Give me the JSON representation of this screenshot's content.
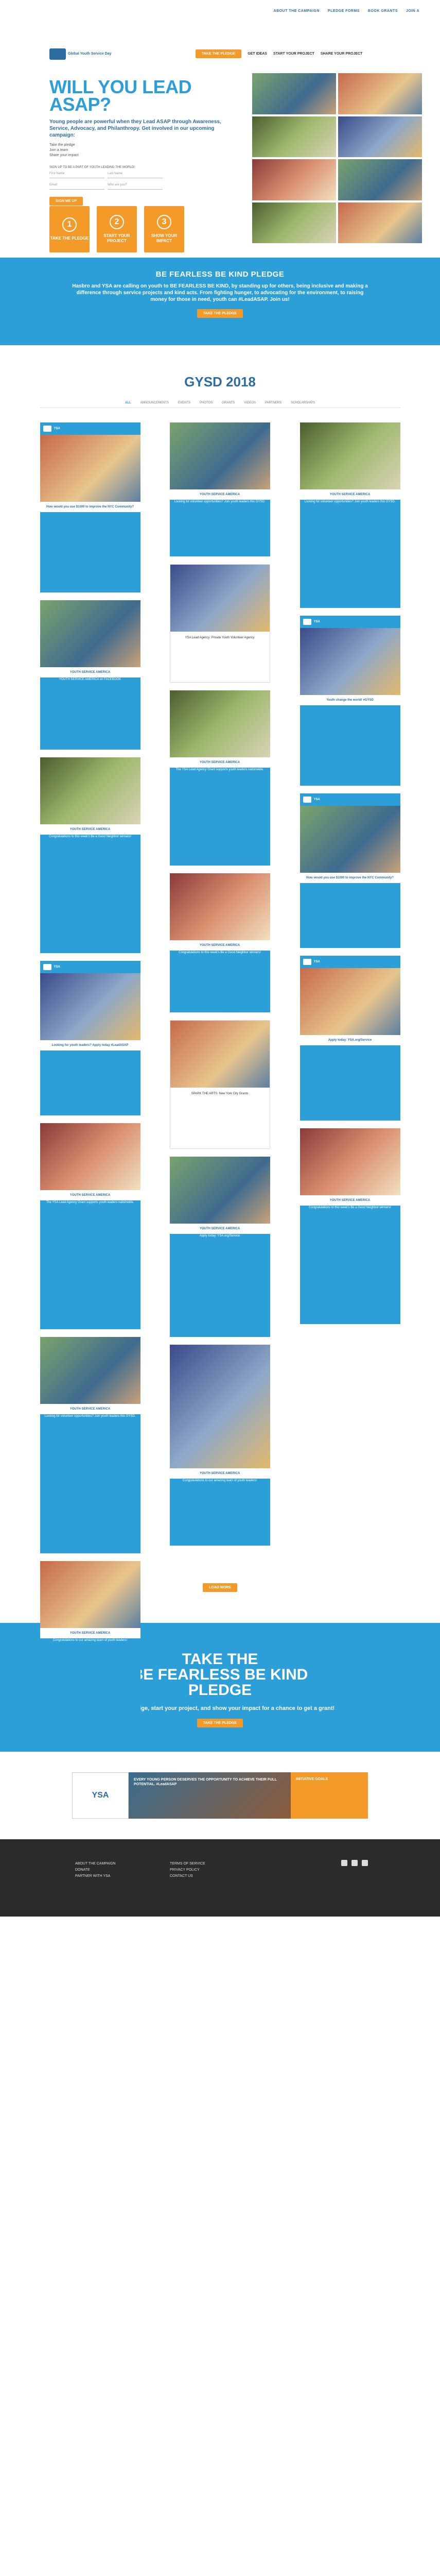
{
  "topnav": {
    "links": [
      "ABOUT THE CAMPAIGN",
      "PLEDGE FORMS",
      "BOOK GRANTS",
      "JOIN A"
    ]
  },
  "hero": {
    "logo_text": "Global Youth Service Day",
    "cta_button": "TAKE THE PLEDGE",
    "cta_links": [
      "GET IDEAS",
      "START YOUR PROJECT",
      "SHARE YOUR PROJECT"
    ],
    "headline": "WILL YOU LEAD ASAP?",
    "subhead": "Young people are powerful when they Lead ASAP through Awareness, Service, Advocacy, and Philanthropy. Get involved in our upcoming campaign:",
    "bullets": [
      "Take the pledge",
      "Join a team",
      "Share your impact"
    ],
    "form_label": "SIGN UP TO BE A PART OF YOUTH LEADING THE WORLD!",
    "form_fields": [
      "First Name",
      "Last Name",
      "Email",
      "Who are you?"
    ],
    "submit": "SIGN ME UP",
    "steps": [
      {
        "num": "1",
        "label": "TAKE THE PLEDGE"
      },
      {
        "num": "2",
        "label": "START YOUR PROJECT"
      },
      {
        "num": "3",
        "label": "SHOW YOUR IMPACT"
      }
    ]
  },
  "pledge": {
    "title": "BE FEARLESS BE KIND PLEDGE",
    "text": "Hasbro and YSA are calling on youth to BE FEARLESS BE KIND, by standing up for others, being inclusive and making a difference through service projects and kind acts. From fighting hunger, to advocating for the environment, to raising money for those in need, youth can #LeadASAP. Join us!",
    "button": "TAKE THE PLEDGE"
  },
  "gysd": {
    "title": "GYSD 2018",
    "filters": [
      "ALL",
      "ANNOUNCEMENTS",
      "EVENTS",
      "PHOTOS",
      "GRANTS",
      "VIDEOS",
      "PARTNERS",
      "SCHOLARSHIPS"
    ]
  },
  "cards": [
    {
      "name": "YSA",
      "text": "How would you use $1000 to improve the NYC Community?"
    },
    {
      "name": "YOUTH SERVICE AMERICA",
      "text": "YOUTH SERVICE AMERICA on FACEBOOK"
    },
    {
      "name": "YSA",
      "text": "Looking for youth leaders? Apply today #LeadASAP"
    },
    {
      "name": "YOUTH SERVICE AMERICA",
      "text": "Looking for volunteer opportunities? Join youth leaders this GYSD."
    },
    {
      "name": "YSA Lead Agency",
      "text": "YSA Lead Agency: Private Youth Volunteer Agency"
    },
    {
      "name": "YSA",
      "text": "Youth change the world! #GYSD"
    },
    {
      "name": "YOUTH SERVICE AMERICA",
      "text": "Congratulations to this week's Be a Good Neighbor winners!"
    },
    {
      "name": "YSA",
      "text": "SPARK THE ARTS: New York City Grants"
    },
    {
      "name": "YOUTH SERVICE AMERICA",
      "text": "The YSA Lead Agency Grant supports youth leaders nationwide."
    },
    {
      "name": "YSA",
      "text": "Apply today: YSA.org/Service"
    },
    {
      "name": "YOUTH SERVICE AMERICA",
      "text": "Congratulations to our amazing team of youth leaders!"
    }
  ],
  "loadmore": "LOAD MORE",
  "bigpledge": {
    "title_lines": [
      "TAKE THE",
      "BE FEARLESS BE KIND",
      "PLEDGE"
    ],
    "text": "Take the pledge, start your project, and show your impact for a chance to get a grant!",
    "button": "TAKE THE PLEDGE"
  },
  "about": {
    "logo": "YSA",
    "headline": "EVERY YOUNG PERSON DESERVES THE OPPORTUNITY TO ACHIEVE THEIR FULL POTENTIAL. #LeadASAP",
    "initiative": "INITIATIVE GOALS"
  },
  "footer": {
    "links1": [
      "ABOUT THE CAMPAIGN",
      "DONATE",
      "PARTNER WITH YSA"
    ],
    "links2": [
      "TERMS OF SERVICE",
      "PRIVACY POLICY",
      "CONTACT US"
    ]
  }
}
